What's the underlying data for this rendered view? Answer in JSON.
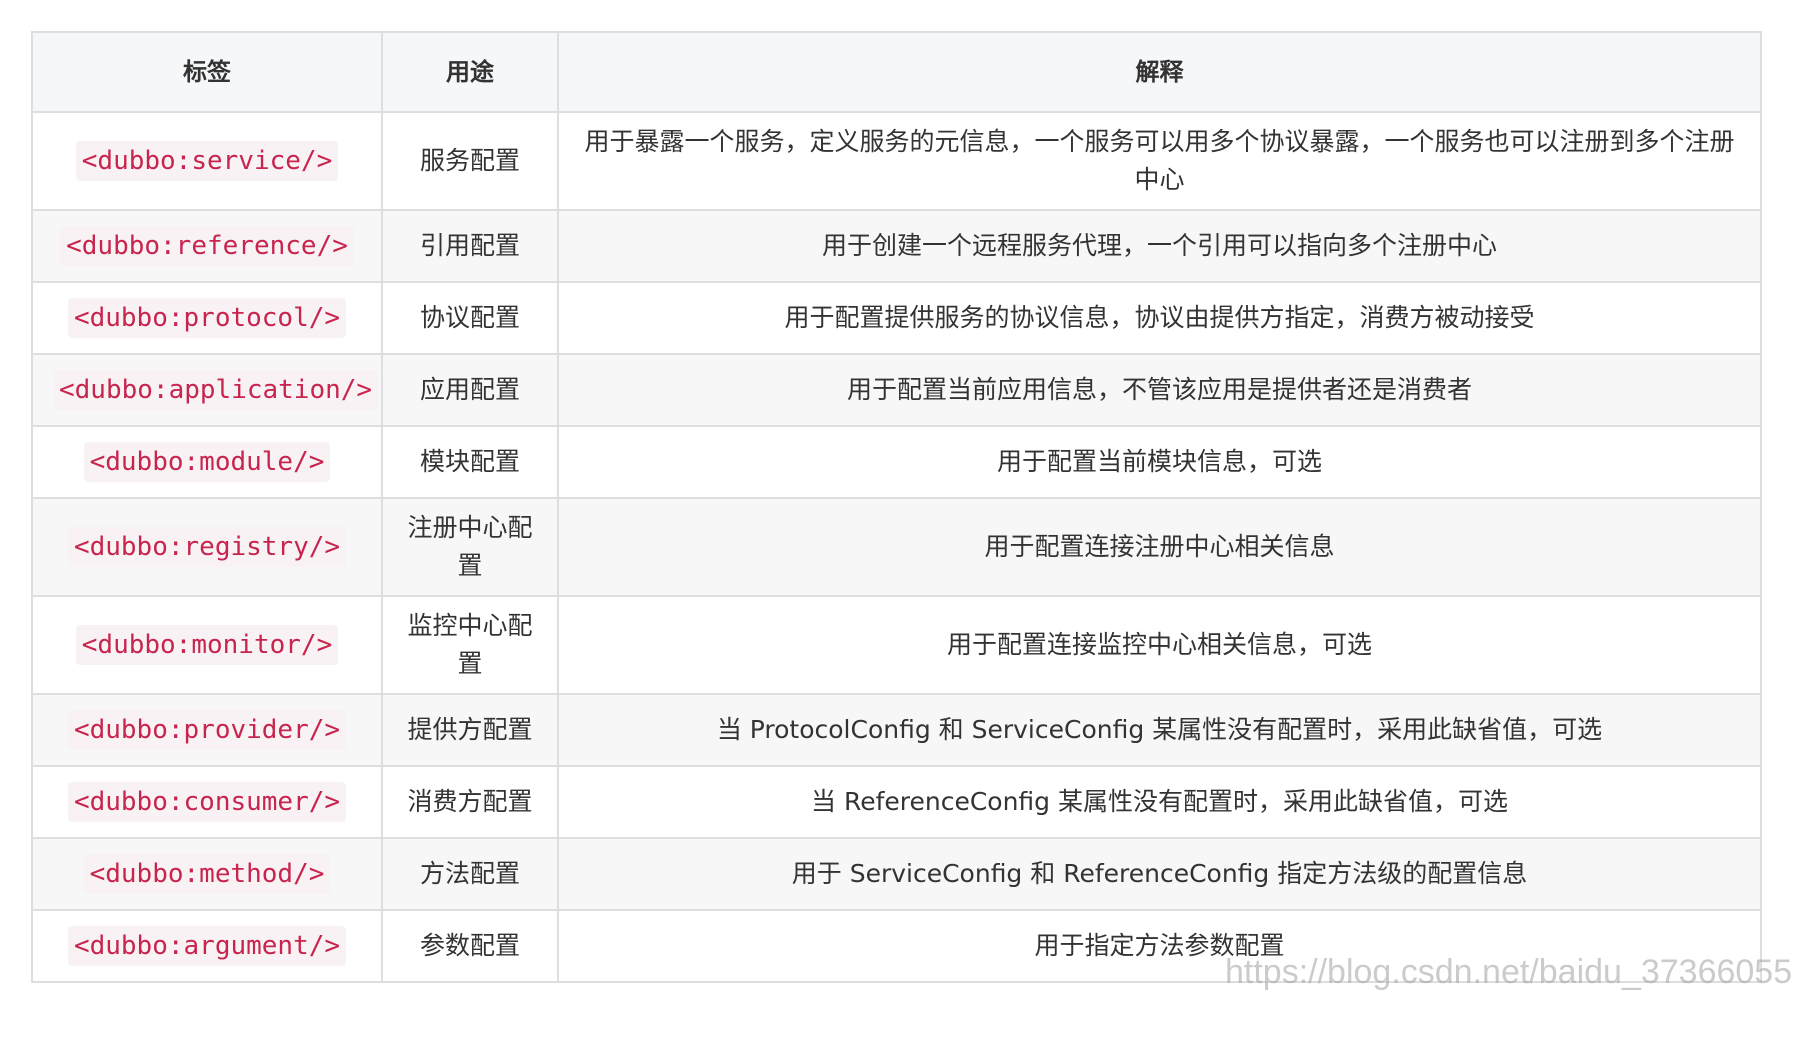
{
  "table": {
    "headers": {
      "tag": "标签",
      "use": "用途",
      "desc": "解释"
    },
    "rows": [
      {
        "tag": "<dubbo:service/>",
        "use": "服务配置",
        "desc": "用于暴露一个服务，定义服务的元信息，一个服务可以用多个协议暴露，一个服务也可以注册到多个注册中心"
      },
      {
        "tag": "<dubbo:reference/>",
        "use": "引用配置",
        "desc": "用于创建一个远程服务代理，一个引用可以指向多个注册中心"
      },
      {
        "tag": "<dubbo:protocol/>",
        "use": "协议配置",
        "desc": "用于配置提供服务的协议信息，协议由提供方指定，消费方被动接受"
      },
      {
        "tag": "<dubbo:application/>",
        "use": "应用配置",
        "desc": "用于配置当前应用信息，不管该应用是提供者还是消费者"
      },
      {
        "tag": "<dubbo:module/>",
        "use": "模块配置",
        "desc": "用于配置当前模块信息，可选"
      },
      {
        "tag": "<dubbo:registry/>",
        "use": "注册中心配置",
        "desc": "用于配置连接注册中心相关信息"
      },
      {
        "tag": "<dubbo:monitor/>",
        "use": "监控中心配置",
        "desc": "用于配置连接监控中心相关信息，可选"
      },
      {
        "tag": "<dubbo:provider/>",
        "use": "提供方配置",
        "desc": "当 ProtocolConfig 和 ServiceConfig 某属性没有配置时，采用此缺省值，可选"
      },
      {
        "tag": "<dubbo:consumer/>",
        "use": "消费方配置",
        "desc": "当 ReferenceConfig 某属性没有配置时，采用此缺省值，可选"
      },
      {
        "tag": "<dubbo:method/>",
        "use": "方法配置",
        "desc": "用于 ServiceConfig 和 ReferenceConfig 指定方法级的配置信息"
      },
      {
        "tag": "<dubbo:argument/>",
        "use": "参数配置",
        "desc": "用于指定方法参数配置"
      }
    ]
  },
  "watermark": "https://blog.csdn.net/baidu_37366055"
}
